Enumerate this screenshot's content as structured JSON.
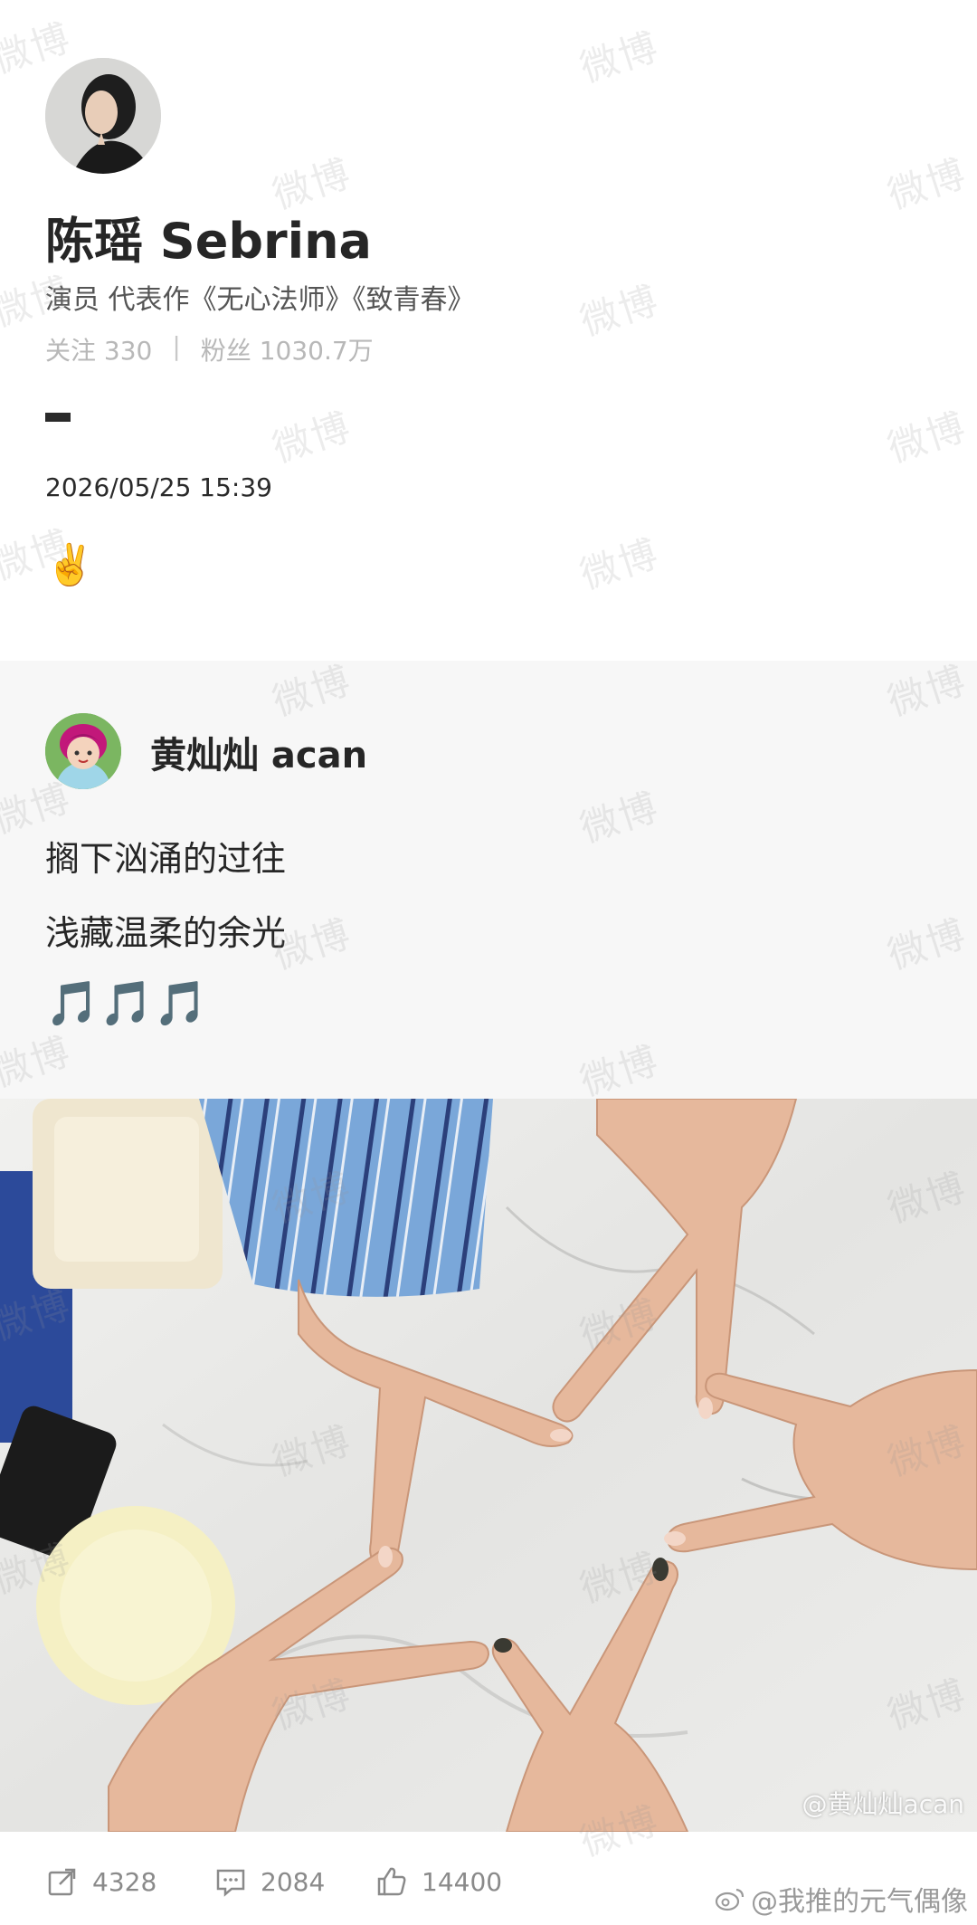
{
  "profile": {
    "name": "陈瑶 Sebrina",
    "bio": "演员 代表作《无心法师》《致青春》",
    "following_label": "关注 330",
    "followers_label": "粉丝 1030.7万",
    "separator": "|",
    "avatar_icon": "user-avatar-photo"
  },
  "post": {
    "time": "2026/05/25 15:39",
    "emoji": "✌️"
  },
  "repost": {
    "author": "黄灿灿 acan",
    "line1": "搁下汹涌的过往",
    "line2": "浅藏温柔的余光",
    "line3": "🎵🎵🎵",
    "avatar_icon": "cartoon-girl-avatar"
  },
  "photo": {
    "credit": "@黄灿灿acan",
    "description_icon": "peace-sign-hands-photo"
  },
  "actions": {
    "repost_count": "4328",
    "comment_count": "2084",
    "like_count": "14400"
  },
  "watermark": {
    "text": "微博",
    "bottom_credit": "@我推的元气偶像"
  },
  "colors": {
    "accent_gray": "#8a8a8a",
    "repost_bg": "#f7f7f7"
  }
}
